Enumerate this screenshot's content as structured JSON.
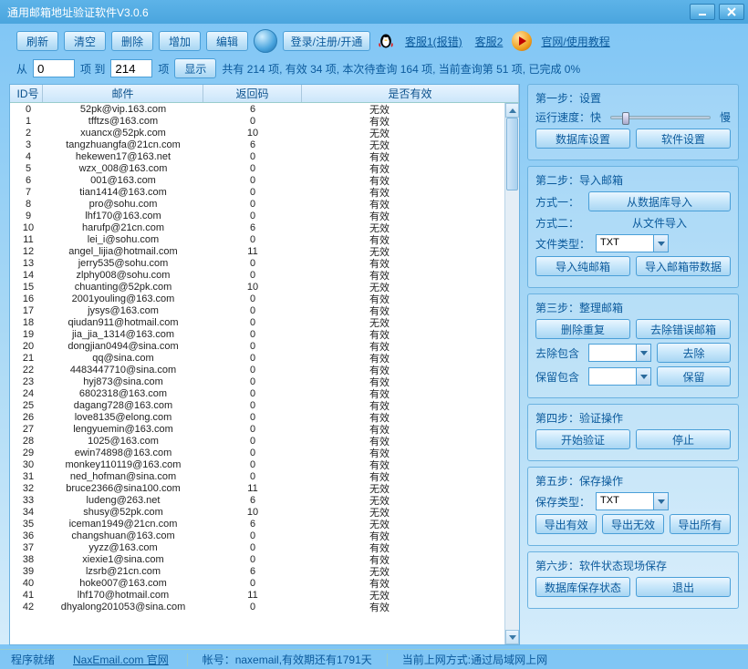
{
  "title": "通用邮箱地址验证软件V3.0.6",
  "toolbar": {
    "refresh": "刷新",
    "clear": "清空",
    "delete": "删除",
    "add": "增加",
    "edit": "编辑",
    "login": "登录/注册/开通",
    "cs1": "客服1(报错)",
    "cs2": "客服2",
    "tutorial": "官网/使用教程"
  },
  "row2": {
    "from": "从",
    "to": "项 到",
    "unit": "项",
    "from_val": "0",
    "to_val": "214",
    "show": "显示",
    "summary": "共有 214 项, 有效 34 项, 本次待查询 164 项, 当前查询第 51 项, 已完成 0%"
  },
  "thead": {
    "id": "ID号",
    "mail": "邮件",
    "code": "返回码",
    "valid": "是否有效"
  },
  "rows": [
    {
      "id": "0",
      "mail": "52pk@vip.163.com",
      "code": "6",
      "valid": "无效"
    },
    {
      "id": "1",
      "mail": "tfftzs@163.com",
      "code": "0",
      "valid": "有效"
    },
    {
      "id": "2",
      "mail": "xuancx@52pk.com",
      "code": "10",
      "valid": "无效"
    },
    {
      "id": "3",
      "mail": "tangzhuangfa@21cn.com",
      "code": "6",
      "valid": "无效"
    },
    {
      "id": "4",
      "mail": "hekewen17@163.net",
      "code": "0",
      "valid": "有效"
    },
    {
      "id": "5",
      "mail": "wzx_008@163.com",
      "code": "0",
      "valid": "有效"
    },
    {
      "id": "6",
      "mail": "001@163.com",
      "code": "0",
      "valid": "有效"
    },
    {
      "id": "7",
      "mail": "tian1414@163.com",
      "code": "0",
      "valid": "有效"
    },
    {
      "id": "8",
      "mail": "pro@sohu.com",
      "code": "0",
      "valid": "有效"
    },
    {
      "id": "9",
      "mail": "lhf170@163.com",
      "code": "0",
      "valid": "有效"
    },
    {
      "id": "10",
      "mail": "harufp@21cn.com",
      "code": "6",
      "valid": "无效"
    },
    {
      "id": "11",
      "mail": "lei_i@sohu.com",
      "code": "0",
      "valid": "有效"
    },
    {
      "id": "12",
      "mail": "angel_lijia@hotmail.com",
      "code": "11",
      "valid": "无效"
    },
    {
      "id": "13",
      "mail": "jerry535@sohu.com",
      "code": "0",
      "valid": "有效"
    },
    {
      "id": "14",
      "mail": "zlphy008@sohu.com",
      "code": "0",
      "valid": "有效"
    },
    {
      "id": "15",
      "mail": "chuanting@52pk.com",
      "code": "10",
      "valid": "无效"
    },
    {
      "id": "16",
      "mail": "2001youling@163.com",
      "code": "0",
      "valid": "有效"
    },
    {
      "id": "17",
      "mail": "jysys@163.com",
      "code": "0",
      "valid": "有效"
    },
    {
      "id": "18",
      "mail": "qiudan911@hotmail.com",
      "code": "0",
      "valid": "无效"
    },
    {
      "id": "19",
      "mail": "jia_jia_1314@163.com",
      "code": "0",
      "valid": "有效"
    },
    {
      "id": "20",
      "mail": "dongjian0494@sina.com",
      "code": "0",
      "valid": "有效"
    },
    {
      "id": "21",
      "mail": "qq@sina.com",
      "code": "0",
      "valid": "有效"
    },
    {
      "id": "22",
      "mail": "4483447710@sina.com",
      "code": "0",
      "valid": "有效"
    },
    {
      "id": "23",
      "mail": "hyj873@sina.com",
      "code": "0",
      "valid": "有效"
    },
    {
      "id": "24",
      "mail": "6802318@163.com",
      "code": "0",
      "valid": "有效"
    },
    {
      "id": "25",
      "mail": "dagang728@163.com",
      "code": "0",
      "valid": "有效"
    },
    {
      "id": "26",
      "mail": "love8135@elong.com",
      "code": "0",
      "valid": "有效"
    },
    {
      "id": "27",
      "mail": "lengyuemin@163.com",
      "code": "0",
      "valid": "有效"
    },
    {
      "id": "28",
      "mail": "1025@163.com",
      "code": "0",
      "valid": "有效"
    },
    {
      "id": "29",
      "mail": "ewin74898@163.com",
      "code": "0",
      "valid": "有效"
    },
    {
      "id": "30",
      "mail": "monkey110119@163.com",
      "code": "0",
      "valid": "有效"
    },
    {
      "id": "31",
      "mail": "ned_hofman@sina.com",
      "code": "0",
      "valid": "有效"
    },
    {
      "id": "32",
      "mail": "bruce2366@sina100.com",
      "code": "11",
      "valid": "无效"
    },
    {
      "id": "33",
      "mail": "ludeng@263.net",
      "code": "6",
      "valid": "无效"
    },
    {
      "id": "34",
      "mail": "shusy@52pk.com",
      "code": "10",
      "valid": "无效"
    },
    {
      "id": "35",
      "mail": "iceman1949@21cn.com",
      "code": "6",
      "valid": "无效"
    },
    {
      "id": "36",
      "mail": "changshuan@163.com",
      "code": "0",
      "valid": "有效"
    },
    {
      "id": "37",
      "mail": "yyzz@163.com",
      "code": "0",
      "valid": "有效"
    },
    {
      "id": "38",
      "mail": "xiexie1@sina.com",
      "code": "0",
      "valid": "有效"
    },
    {
      "id": "39",
      "mail": "lzsrb@21cn.com",
      "code": "6",
      "valid": "无效"
    },
    {
      "id": "40",
      "mail": "hoke007@163.com",
      "code": "0",
      "valid": "有效"
    },
    {
      "id": "41",
      "mail": "lhf170@hotmail.com",
      "code": "11",
      "valid": "无效"
    },
    {
      "id": "42",
      "mail": "dhyalong201053@sina.com",
      "code": "0",
      "valid": "有效"
    }
  ],
  "step1": {
    "title": "第一步：设置",
    "speed_label": "运行速度：快",
    "slow": "慢",
    "db": "数据库设置",
    "sw": "软件设置"
  },
  "step2": {
    "title": "第二步：导入邮箱",
    "m1": "方式一：",
    "m2": "方式二：",
    "fromdb": "从数据库导入",
    "fromfile": "从文件导入",
    "ftype": "文件类型：",
    "ftype_val": "TXT",
    "importpure": "导入纯邮箱",
    "importdata": "导入邮箱带数据"
  },
  "step3": {
    "title": "第三步：整理邮箱",
    "dedup": "删除重复",
    "removebad": "去除错误邮箱",
    "excl": "去除包含",
    "incl": "保留包含",
    "remove": "去除",
    "keep": "保留"
  },
  "step4": {
    "title": "第四步：验证操作",
    "start": "开始验证",
    "stop": "停止"
  },
  "step5": {
    "title": "第五步：保存操作",
    "stype": "保存类型：",
    "stype_val": "TXT",
    "exvalid": "导出有效",
    "exinvalid": "导出无效",
    "exall": "导出所有"
  },
  "step6": {
    "title": "第六步：软件状态现场保存",
    "savestate": "数据库保存状态",
    "exit": "退出"
  },
  "status": {
    "ready": "程序就绪",
    "site": "NaxEmail.com 官网",
    "account": "帐号：naxemail,有效期还有1791天",
    "net": "当前上网方式:通过局域网上网"
  }
}
